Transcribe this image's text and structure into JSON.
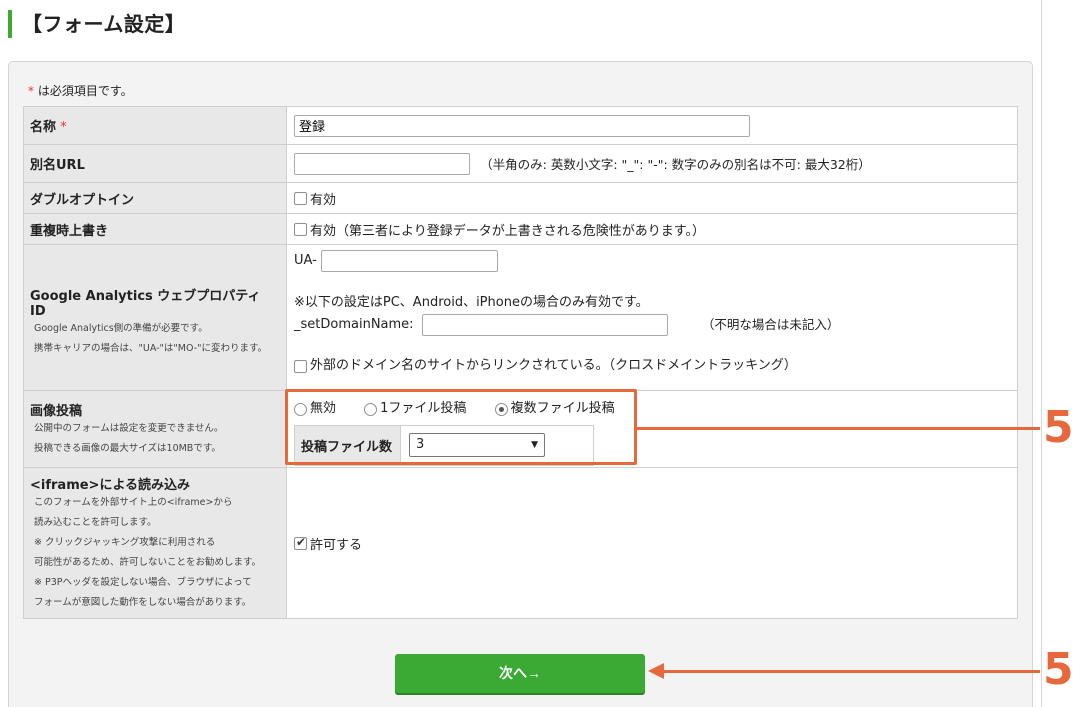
{
  "page": {
    "title": "【フォーム設定】"
  },
  "required_note": {
    "star": "*",
    "text": "は必須項目です。"
  },
  "rows": {
    "name": {
      "label": "名称",
      "star": "*",
      "value": "登録"
    },
    "alias_url": {
      "label": "別名URL",
      "value": "",
      "hint": "（半角のみ: 英数小文字: \"_\": \"-\": 数字のみの別名は不可: 最大32桁）"
    },
    "double_optin": {
      "label": "ダブルオプトイン",
      "checkbox_label": "有効",
      "checked": false
    },
    "overwrite": {
      "label": "重複時上書き",
      "checkbox_label": "有効（第三者により登録データが上書きされる危険性があります。）",
      "checked": false
    },
    "ga": {
      "label": "Google Analytics ウェブプロパティ ID",
      "sub1": "Google Analytics側の準備が必要です。",
      "sub2": "携帯キャリアの場合は、\"UA-\"は\"MO-\"に変わります。",
      "ua_prefix": "UA-",
      "ua_value": "",
      "note": "※以下の設定はPC、Android、iPhoneの場合のみ有効です。",
      "domain_label": "_setDomainName:",
      "domain_value": "",
      "domain_hint": "（不明な場合は未記入）",
      "cross_label": "外部のドメイン名のサイトからリンクされている。（クロスドメイントラッキング）",
      "cross_checked": false
    },
    "image": {
      "label": "画像投稿",
      "sub1": "公開中のフォームは設定を変更できません。",
      "sub2": "投稿できる画像の最大サイズは10MBです。",
      "options": [
        "無効",
        "1ファイル投稿",
        "複数ファイル投稿"
      ],
      "selected": "複数ファイル投稿",
      "count_label": "投稿ファイル数",
      "count_value": "3"
    },
    "iframe": {
      "label": "<iframe>による読み込み",
      "sub": [
        "このフォームを外部サイト上の<iframe>から",
        "読み込むことを許可します。",
        "※ クリックジャッキング攻撃に利用される",
        "可能性があるため、許可しないことをお勧めします。",
        "※ P3Pヘッダを設定しない場合、ブラウザによって",
        "フォームが意図した動作をしない場合があります。"
      ],
      "checkbox_label": "許可する",
      "checked": true
    }
  },
  "next_button": {
    "label": "次へ→"
  },
  "annotations": {
    "callout_1": "5",
    "callout_2": "5",
    "color": "#e8683d"
  },
  "colors": {
    "accent": "#3aaa35",
    "label_bg": "#e8e8e8",
    "annotation": "#e8683d"
  }
}
